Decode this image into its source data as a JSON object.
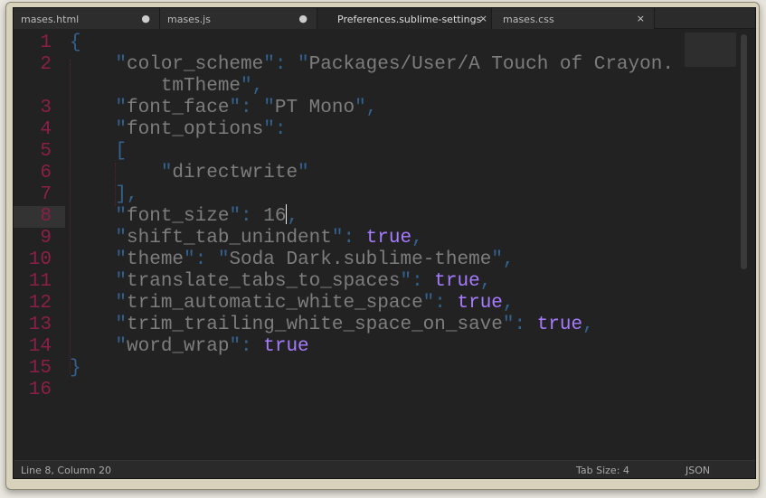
{
  "tabs": [
    {
      "label": "mases.html",
      "status": "modified-dot",
      "icon": "●"
    },
    {
      "label": "mases.js",
      "status": "modified-dot",
      "icon": "●"
    },
    {
      "label": "Preferences.sublime-settings",
      "status": "close",
      "icon": "×",
      "active": true
    },
    {
      "label": "mases.css",
      "status": "close",
      "icon": "×"
    }
  ],
  "colors": {
    "line_number": "#8b1f48",
    "punctuation": "#33628f",
    "string": "#7d7d7d",
    "boolean": "#a77bff",
    "background": "#222222"
  },
  "lines": [
    {
      "n": "1",
      "tokens": [
        [
          "p",
          "{"
        ]
      ]
    },
    {
      "n": "2",
      "tokens": [
        [
          "p",
          "    \""
        ],
        [
          "s",
          "color_scheme"
        ],
        [
          "p",
          "\": \""
        ],
        [
          "s",
          "Packages/User/A Touch of Crayon."
        ]
      ]
    },
    {
      "n": "",
      "tokens": [
        [
          "s",
          "        tmTheme"
        ],
        [
          "p",
          "\","
        ]
      ]
    },
    {
      "n": "3",
      "tokens": [
        [
          "p",
          "    \""
        ],
        [
          "s",
          "font_face"
        ],
        [
          "p",
          "\": \""
        ],
        [
          "s",
          "PT Mono"
        ],
        [
          "p",
          "\","
        ]
      ]
    },
    {
      "n": "4",
      "tokens": [
        [
          "p",
          "    \""
        ],
        [
          "s",
          "font_options"
        ],
        [
          "p",
          "\":"
        ]
      ]
    },
    {
      "n": "5",
      "tokens": [
        [
          "p",
          "    ["
        ]
      ]
    },
    {
      "n": "6",
      "tokens": [
        [
          "p",
          "        \""
        ],
        [
          "s",
          "directwrite"
        ],
        [
          "p",
          "\""
        ]
      ]
    },
    {
      "n": "7",
      "tokens": [
        [
          "p",
          "    ],"
        ]
      ]
    },
    {
      "n": "8",
      "tokens": [
        [
          "p",
          "    \""
        ],
        [
          "s",
          "font_size"
        ],
        [
          "p",
          "\": "
        ],
        [
          "n",
          "16"
        ],
        [
          "cursor",
          ""
        ],
        [
          "p",
          ","
        ]
      ],
      "current": true
    },
    {
      "n": "9",
      "tokens": [
        [
          "p",
          "    \""
        ],
        [
          "s",
          "shift_tab_unindent"
        ],
        [
          "p",
          "\": "
        ],
        [
          "t",
          "true"
        ],
        [
          "p",
          ","
        ]
      ]
    },
    {
      "n": "10",
      "tokens": [
        [
          "p",
          "    \""
        ],
        [
          "s",
          "theme"
        ],
        [
          "p",
          "\": \""
        ],
        [
          "s",
          "Soda Dark.sublime-theme"
        ],
        [
          "p",
          "\","
        ]
      ]
    },
    {
      "n": "11",
      "tokens": [
        [
          "p",
          "    \""
        ],
        [
          "s",
          "translate_tabs_to_spaces"
        ],
        [
          "p",
          "\": "
        ],
        [
          "t",
          "true"
        ],
        [
          "p",
          ","
        ]
      ]
    },
    {
      "n": "12",
      "tokens": [
        [
          "p",
          "    \""
        ],
        [
          "s",
          "trim_automatic_white_space"
        ],
        [
          "p",
          "\": "
        ],
        [
          "t",
          "true"
        ],
        [
          "p",
          ","
        ]
      ]
    },
    {
      "n": "13",
      "tokens": [
        [
          "p",
          "    \""
        ],
        [
          "s",
          "trim_trailing_white_space_on_save"
        ],
        [
          "p",
          "\": "
        ],
        [
          "t",
          "true"
        ],
        [
          "p",
          ","
        ]
      ]
    },
    {
      "n": "14",
      "tokens": [
        [
          "p",
          "    \""
        ],
        [
          "s",
          "word_wrap"
        ],
        [
          "p",
          "\": "
        ],
        [
          "t",
          "true"
        ]
      ]
    },
    {
      "n": "15",
      "tokens": [
        [
          "p",
          "}"
        ]
      ]
    },
    {
      "n": "16",
      "tokens": []
    }
  ],
  "status": {
    "position": "Line 8, Column 20",
    "tab_size": "Tab Size: 4",
    "syntax": "JSON"
  }
}
